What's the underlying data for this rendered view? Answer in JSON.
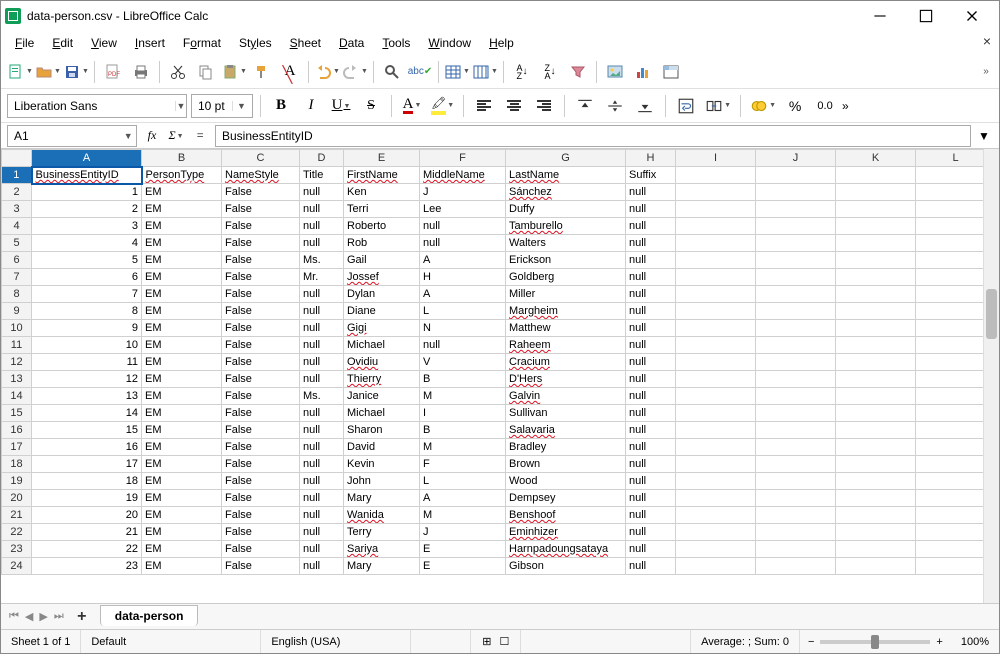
{
  "window": {
    "title": "data-person.csv - LibreOffice Calc"
  },
  "menu": [
    "File",
    "Edit",
    "View",
    "Insert",
    "Format",
    "Styles",
    "Sheet",
    "Data",
    "Tools",
    "Window",
    "Help"
  ],
  "font": {
    "name": "Liberation Sans",
    "size": "10 pt"
  },
  "cellref": {
    "name": "A1"
  },
  "formula": {
    "value": "BusinessEntityID"
  },
  "columns": [
    "A",
    "B",
    "C",
    "D",
    "E",
    "F",
    "G",
    "H",
    "I",
    "J",
    "K",
    "L"
  ],
  "headers": [
    "BusinessEntityID",
    "PersonType",
    "NameStyle",
    "Title",
    "FirstName",
    "MiddleName",
    "LastName",
    "Suffix"
  ],
  "rows": [
    {
      "id": "1",
      "pt": "EM",
      "ns": "False",
      "title": "null",
      "fn": "Ken",
      "mn": "J",
      "ln": "Sánchez",
      "suf": "null",
      "sq": {
        "ln": true
      }
    },
    {
      "id": "2",
      "pt": "EM",
      "ns": "False",
      "title": "null",
      "fn": "Terri",
      "mn": "Lee",
      "ln": "Duffy",
      "suf": "null"
    },
    {
      "id": "3",
      "pt": "EM",
      "ns": "False",
      "title": "null",
      "fn": "Roberto",
      "mn": "null",
      "ln": "Tamburello",
      "suf": "null",
      "sq": {
        "ln": true
      }
    },
    {
      "id": "4",
      "pt": "EM",
      "ns": "False",
      "title": "null",
      "fn": "Rob",
      "mn": "null",
      "ln": "Walters",
      "suf": "null"
    },
    {
      "id": "5",
      "pt": "EM",
      "ns": "False",
      "title": "Ms.",
      "fn": "Gail",
      "mn": "A",
      "ln": "Erickson",
      "suf": "null"
    },
    {
      "id": "6",
      "pt": "EM",
      "ns": "False",
      "title": "Mr.",
      "fn": "Jossef",
      "mn": "H",
      "ln": "Goldberg",
      "suf": "null",
      "sq": {
        "fn": true
      }
    },
    {
      "id": "7",
      "pt": "EM",
      "ns": "False",
      "title": "null",
      "fn": "Dylan",
      "mn": "A",
      "ln": "Miller",
      "suf": "null"
    },
    {
      "id": "8",
      "pt": "EM",
      "ns": "False",
      "title": "null",
      "fn": "Diane",
      "mn": "L",
      "ln": "Margheim",
      "suf": "null",
      "sq": {
        "ln": true
      }
    },
    {
      "id": "9",
      "pt": "EM",
      "ns": "False",
      "title": "null",
      "fn": "Gigi",
      "mn": "N",
      "ln": "Matthew",
      "suf": "null",
      "sq": {
        "fn": true
      }
    },
    {
      "id": "10",
      "pt": "EM",
      "ns": "False",
      "title": "null",
      "fn": "Michael",
      "mn": "null",
      "ln": "Raheem",
      "suf": "null",
      "sq": {
        "ln": true
      }
    },
    {
      "id": "11",
      "pt": "EM",
      "ns": "False",
      "title": "null",
      "fn": "Ovidiu",
      "mn": "V",
      "ln": "Cracium",
      "suf": "null",
      "sq": {
        "fn": true,
        "ln": true
      }
    },
    {
      "id": "12",
      "pt": "EM",
      "ns": "False",
      "title": "null",
      "fn": "Thierry",
      "mn": "B",
      "ln": "D'Hers",
      "suf": "null",
      "sq": {
        "fn": true,
        "ln": true
      }
    },
    {
      "id": "13",
      "pt": "EM",
      "ns": "False",
      "title": "Ms.",
      "fn": "Janice",
      "mn": "M",
      "ln": "Galvin",
      "suf": "null",
      "sq": {
        "ln": true
      }
    },
    {
      "id": "14",
      "pt": "EM",
      "ns": "False",
      "title": "null",
      "fn": "Michael",
      "mn": "I",
      "ln": "Sullivan",
      "suf": "null"
    },
    {
      "id": "15",
      "pt": "EM",
      "ns": "False",
      "title": "null",
      "fn": "Sharon",
      "mn": "B",
      "ln": "Salavaria",
      "suf": "null",
      "sq": {
        "ln": true
      }
    },
    {
      "id": "16",
      "pt": "EM",
      "ns": "False",
      "title": "null",
      "fn": "David",
      "mn": "M",
      "ln": "Bradley",
      "suf": "null"
    },
    {
      "id": "17",
      "pt": "EM",
      "ns": "False",
      "title": "null",
      "fn": "Kevin",
      "mn": "F",
      "ln": "Brown",
      "suf": "null"
    },
    {
      "id": "18",
      "pt": "EM",
      "ns": "False",
      "title": "null",
      "fn": "John",
      "mn": "L",
      "ln": "Wood",
      "suf": "null"
    },
    {
      "id": "19",
      "pt": "EM",
      "ns": "False",
      "title": "null",
      "fn": "Mary",
      "mn": "A",
      "ln": "Dempsey",
      "suf": "null"
    },
    {
      "id": "20",
      "pt": "EM",
      "ns": "False",
      "title": "null",
      "fn": "Wanida",
      "mn": "M",
      "ln": "Benshoof",
      "suf": "null",
      "sq": {
        "fn": true,
        "ln": true
      }
    },
    {
      "id": "21",
      "pt": "EM",
      "ns": "False",
      "title": "null",
      "fn": "Terry",
      "mn": "J",
      "ln": "Eminhizer",
      "suf": "null",
      "sq": {
        "ln": true
      }
    },
    {
      "id": "22",
      "pt": "EM",
      "ns": "False",
      "title": "null",
      "fn": "Sariya",
      "mn": "E",
      "ln": "Harnpadoungsataya",
      "suf": "null",
      "sq": {
        "fn": true,
        "ln": true
      }
    },
    {
      "id": "23",
      "pt": "EM",
      "ns": "False",
      "title": "null",
      "fn": "Mary",
      "mn": "E",
      "ln": "Gibson",
      "suf": "null"
    }
  ],
  "sheet_tab": "data-person",
  "status": {
    "sheet": "Sheet 1 of 1",
    "style": "Default",
    "lang": "English (USA)",
    "summary": "Average: ; Sum: 0",
    "zoom": "100%"
  }
}
